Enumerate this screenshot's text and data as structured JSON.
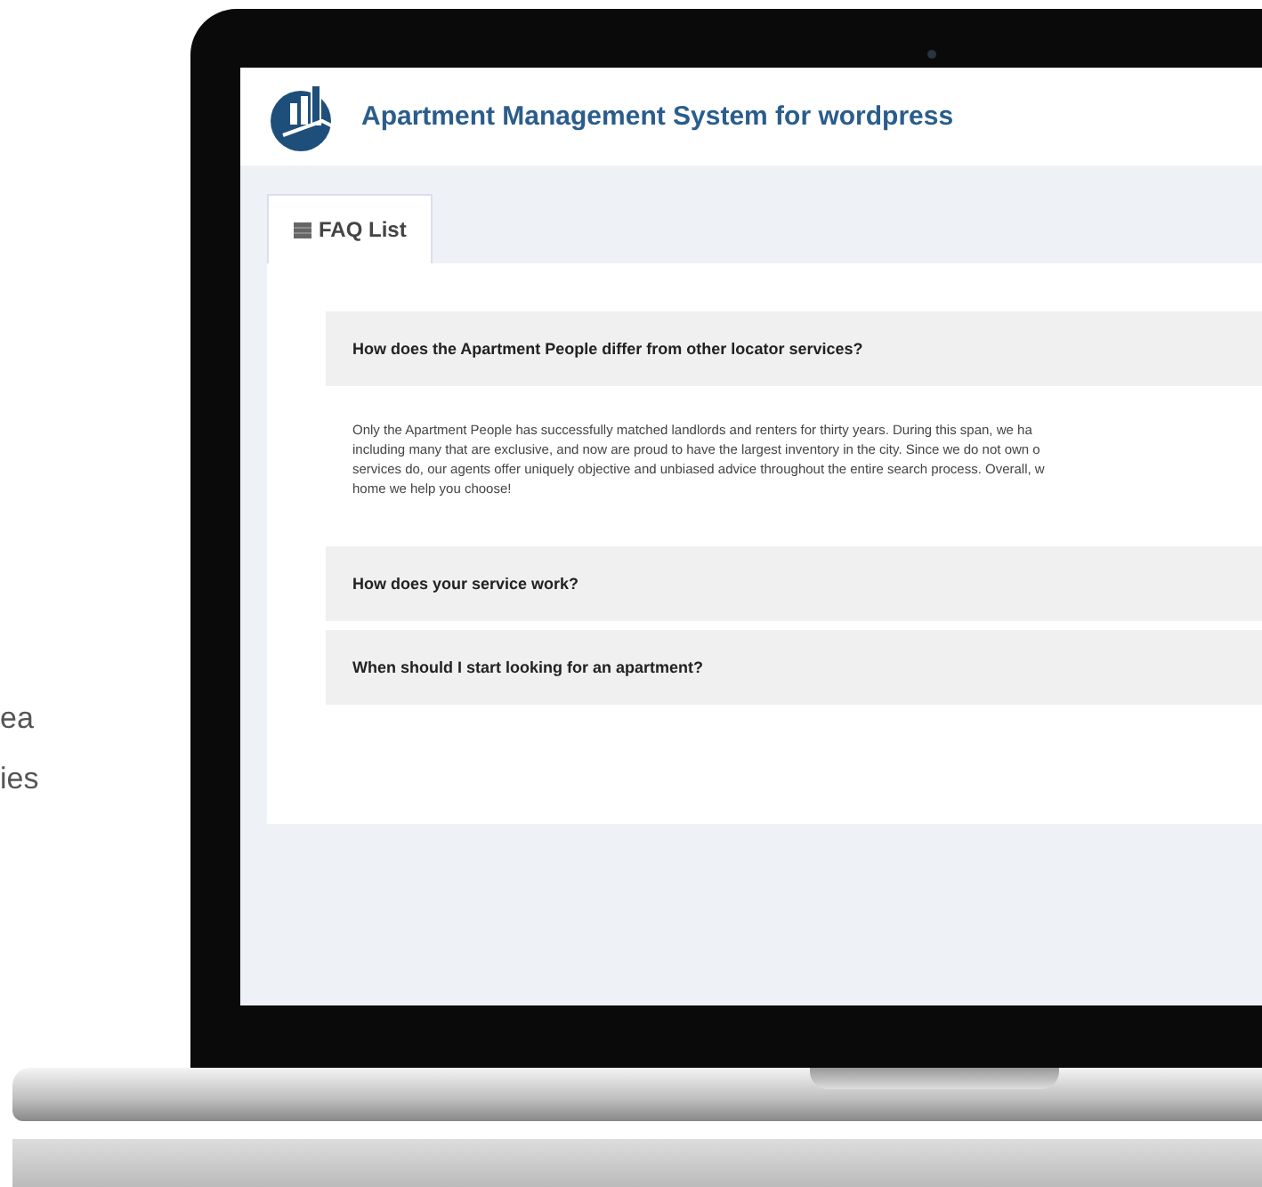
{
  "side_text": [
    "ea",
    "ies"
  ],
  "app": {
    "title": "Apartment Management System for wordpress"
  },
  "tabs": [
    {
      "label": "FAQ List",
      "selected": true
    }
  ],
  "faqs": [
    {
      "question": "How does the Apartment People differ from other locator services?",
      "answer_lines": [
        "Only the Apartment People has successfully matched landlords and renters for thirty years. During this span, we ha",
        "including many that are exclusive, and now are proud to have the largest inventory in the city. Since we do not own o",
        "services do, our agents offer uniquely objective and unbiased advice throughout the entire search process. Overall, w",
        "home we help you choose!"
      ]
    },
    {
      "question": "How does your service work?"
    },
    {
      "question": "When should I start looking for an apartment?"
    }
  ]
}
